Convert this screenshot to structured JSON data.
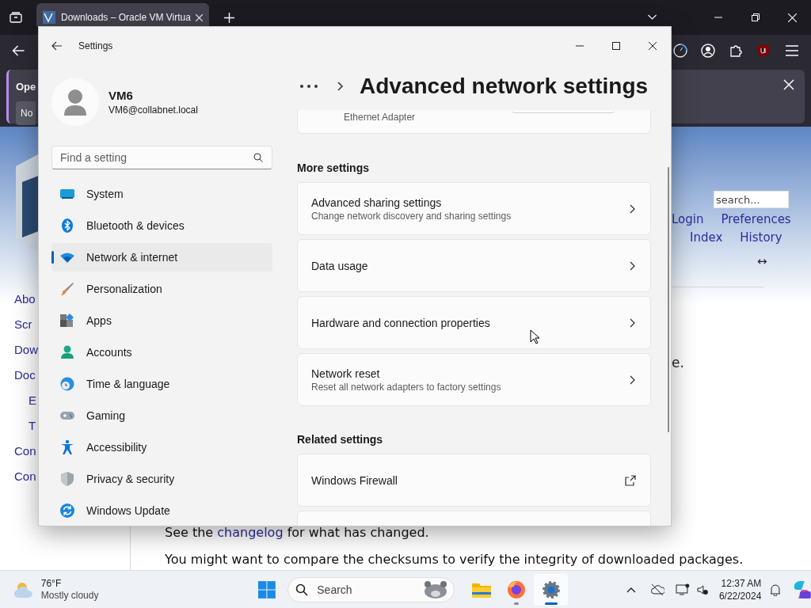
{
  "browser": {
    "tab": {
      "title": "Downloads – Oracle VM Virtua",
      "selected": true
    },
    "notification": {
      "text": "Ope",
      "button": "No"
    },
    "page": {
      "side_links": [
        {
          "text": "Abo"
        },
        {
          "text": "Scr"
        },
        {
          "text": "Dow"
        },
        {
          "text": "Doc",
          "children": [
            {
              "text": "E"
            },
            {
              "text": "T"
            }
          ]
        },
        {
          "text": "Con"
        },
        {
          "text": "Con"
        }
      ],
      "search_placeholder": "search...",
      "user_links": [
        "Login",
        "Preferences"
      ],
      "nav_links": [
        "Index",
        "History"
      ],
      "resize_glyph": "↔",
      "fragment": "e.",
      "changelog_line": {
        "before": "See the",
        "link": "changelog",
        "after": "for what has changed."
      },
      "paragraph": "You might want to compare the checksums to verify the integrity of downloaded packages."
    }
  },
  "settings": {
    "title": "Settings",
    "user": {
      "name": "VM6",
      "email": "VM6@collabnet.local"
    },
    "search": {
      "placeholder": "Find a setting"
    },
    "nav": [
      {
        "label": "System",
        "selected": false
      },
      {
        "label": "Bluetooth & devices",
        "selected": false
      },
      {
        "label": "Network & internet",
        "selected": true
      },
      {
        "label": "Personalization",
        "selected": false
      },
      {
        "label": "Apps",
        "selected": false
      },
      {
        "label": "Accounts",
        "selected": false
      },
      {
        "label": "Time & language",
        "selected": false
      },
      {
        "label": "Gaming",
        "selected": false
      },
      {
        "label": "Accessibility",
        "selected": false
      },
      {
        "label": "Privacy & security",
        "selected": false
      },
      {
        "label": "Windows Update",
        "selected": false
      }
    ],
    "page_title": "Advanced network settings",
    "adapter_card": {
      "subtitle": "Ethernet Adapter"
    },
    "sections": [
      {
        "heading": "More settings",
        "items": [
          {
            "title": "Advanced sharing settings",
            "subtitle": "Change network discovery and sharing settings",
            "kind": "chevron"
          },
          {
            "title": "Data usage",
            "kind": "chevron"
          },
          {
            "title": "Hardware and connection properties",
            "kind": "chevron"
          },
          {
            "title": "Network reset",
            "subtitle": "Reset all network adapters to factory settings",
            "kind": "chevron"
          }
        ]
      },
      {
        "heading": "Related settings",
        "items": [
          {
            "title": "Windows Firewall",
            "kind": "external"
          },
          {
            "kind": "blank"
          }
        ]
      }
    ]
  },
  "taskbar": {
    "weather": {
      "temp": "76°F",
      "condition": "Mostly cloudy"
    },
    "search": {
      "placeholder": "Search"
    },
    "apps": [
      {
        "running": false,
        "selected": false
      },
      {
        "running": true,
        "selected": false
      },
      {
        "running": true,
        "selected": true
      }
    ],
    "clock": {
      "time": "12:37 AM",
      "date": "6/22/2024"
    }
  }
}
